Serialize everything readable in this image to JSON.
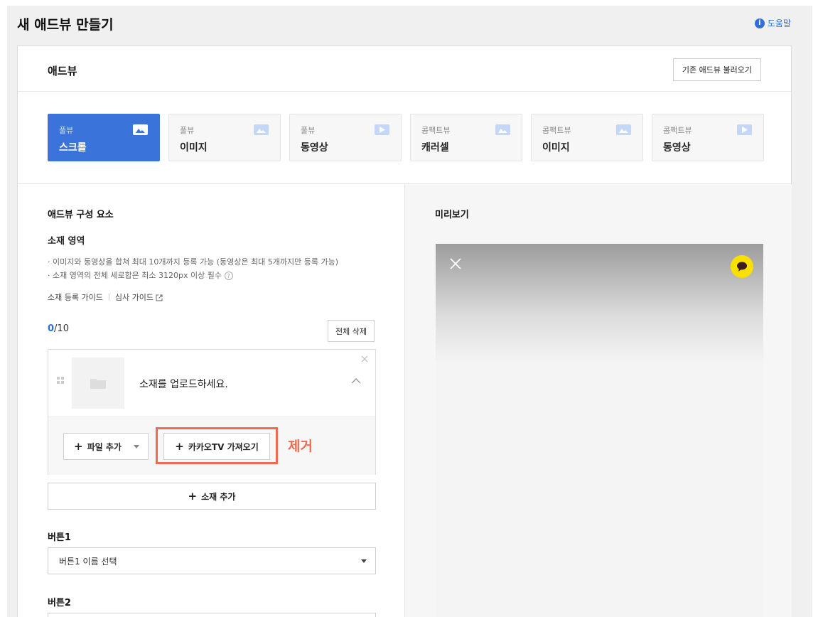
{
  "page": {
    "title": "새 애드뷰 만들기",
    "help_label": "도움말"
  },
  "adview": {
    "section_title": "애드뷰",
    "load_existing_label": "기존 애드뷰 불러오기",
    "types": [
      {
        "small": "풀뷰",
        "big": "스크롤",
        "icon": "image-icon",
        "selected": true
      },
      {
        "small": "풀뷰",
        "big": "이미지",
        "icon": "image-icon",
        "selected": false
      },
      {
        "small": "풀뷰",
        "big": "동영상",
        "icon": "video-icon",
        "selected": false
      },
      {
        "small": "콤팩트뷰",
        "big": "캐러셀",
        "icon": "image-icon",
        "selected": false
      },
      {
        "small": "콤팩트뷰",
        "big": "이미지",
        "icon": "image-icon",
        "selected": false
      },
      {
        "small": "콤팩트뷰",
        "big": "동영상",
        "icon": "video-icon",
        "selected": false
      }
    ]
  },
  "components": {
    "title": "애드뷰 구성 요소",
    "asset_area_title": "소재 영역",
    "notes": [
      "· 이미지와 동영상을 합쳐 최대 10개까지 등록 가능 (동영상은 최대 5개까지만 등록 가능)",
      "· 소재 영역의 전체 세로합은 최소 3120px 이상 필수"
    ],
    "guide_register": "소재 등록 가이드",
    "guide_review": "심사 가이드",
    "count_current": "0",
    "count_total": "/10",
    "delete_all_label": "전체 삭제",
    "upload_prompt": "소재를 업로드하세요.",
    "file_add_label": "파일 추가",
    "kakao_tv_label": "카카오TV 가져오기",
    "remove_annotation": "제거",
    "add_asset_label": "소재 추가",
    "button1_title": "버튼1",
    "button1_placeholder": "버튼1 이름 선택",
    "button2_title": "버튼2"
  },
  "preview": {
    "title": "미리보기"
  },
  "colors": {
    "accent": "#3a73d9",
    "annotation": "#ef6a4f",
    "kakao_yellow": "#f9e000"
  }
}
